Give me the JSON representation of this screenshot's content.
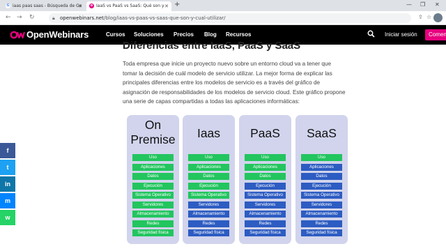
{
  "browser": {
    "tabs": [
      {
        "title": "iaas paas saas - Búsqueda de Go",
        "icon": "google-icon",
        "active": false
      },
      {
        "title": "IaaS vs PaaS vs SaaS: Qué son y",
        "icon": "openwebinars-favicon-icon",
        "active": true
      }
    ],
    "new_tab": "+",
    "url_host": "openwebinars.net",
    "url_path": "/blog/iaas-vs-paas-vs-saas-que-son-y-cual-utilizar/"
  },
  "site": {
    "brand": "OpenWebinars",
    "menu": [
      "Cursos",
      "Soluciones",
      "Precios",
      "Blog",
      "Recursos"
    ],
    "login": "Iniciar sesión",
    "cta": "Comenzar"
  },
  "article": {
    "heading": "Diferencias entre IaaS, PaaS y SaaS",
    "paragraph": "Toda empresa que inicie un proyecto nuevo sobre un entorno cloud va a tener que tomar la decisión de cuál modelo de servicio utilizar. La mejor forma de explicar las principales diferencias entre los modelos de servicio es a través del gráfico de asignación de responsabilidades de los modelos de servicio cloud. Este gráfico propone una serie de capas compartidas a todas las aplicaciones informáticas:"
  },
  "colors": {
    "you_manage": "#22c55e",
    "provider_manages": "#2d5cc2",
    "column_bg": "#d1d4ec",
    "brand_pink": "#e6007e"
  },
  "chart_data": {
    "type": "table",
    "columns": [
      {
        "title": "On Premise",
        "title_lines": [
          "On",
          "Premise"
        ],
        "layers": [
          "Uso",
          "Aplicaciones",
          "Datos",
          "Ejecución",
          "Sistema Operativo",
          "Servidores",
          "Almacenamiento",
          "Redes",
          "Seguridad física"
        ],
        "managed_by_user": [
          true,
          true,
          true,
          true,
          true,
          true,
          true,
          true,
          true
        ]
      },
      {
        "title": "Iaas",
        "title_lines": [
          "Iaas"
        ],
        "layers": [
          "Uso",
          "Aplicaciones",
          "Datos",
          "Ejecución",
          "Sistema Operativo",
          "Servidores",
          "Almacenamiento",
          "Redes",
          "Seguridad física"
        ],
        "managed_by_user": [
          true,
          true,
          true,
          true,
          true,
          false,
          false,
          false,
          false
        ]
      },
      {
        "title": "PaaS",
        "title_lines": [
          "PaaS"
        ],
        "layers": [
          "Uso",
          "Aplicaciones",
          "Datos",
          "Ejecución",
          "Sistema Operativo",
          "Servidores",
          "Almacenamiento",
          "Redes",
          "Seguridad física"
        ],
        "managed_by_user": [
          true,
          true,
          true,
          false,
          false,
          false,
          false,
          false,
          false
        ]
      },
      {
        "title": "SaaS",
        "title_lines": [
          "SaaS"
        ],
        "layers": [
          "Uso",
          "Aplicaciones",
          "Datos",
          "Ejecución",
          "Sistema Operativo",
          "Servidores",
          "Almacenamiento",
          "Redes",
          "Seguridad física"
        ],
        "managed_by_user": [
          true,
          false,
          false,
          false,
          false,
          false,
          false,
          false,
          false
        ]
      }
    ]
  },
  "social": [
    {
      "icon": "facebook-icon",
      "glyph": "f",
      "color": "#3b5998"
    },
    {
      "icon": "twitter-icon",
      "glyph": "t",
      "color": "#1da1f2"
    },
    {
      "icon": "linkedin-icon",
      "glyph": "in",
      "color": "#0e76a8"
    },
    {
      "icon": "messenger-icon",
      "glyph": "m",
      "color": "#0084ff"
    },
    {
      "icon": "whatsapp-icon",
      "glyph": "w",
      "color": "#25d366"
    }
  ]
}
